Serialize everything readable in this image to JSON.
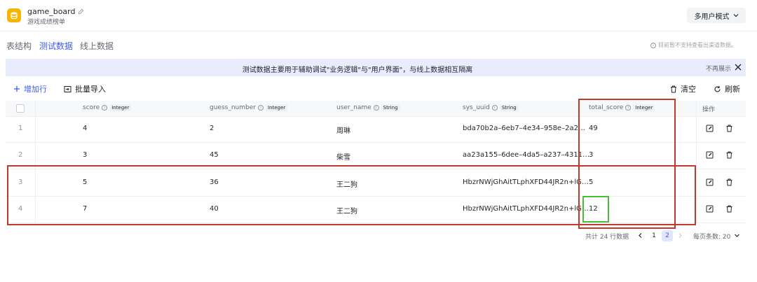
{
  "header": {
    "title": "game_board",
    "subtitle": "游戏成绩榜单",
    "mode_button": "多用户模式"
  },
  "tabs": [
    {
      "label": "表结构",
      "active": false
    },
    {
      "label": "测试数据",
      "active": true
    },
    {
      "label": "线上数据",
      "active": false
    }
  ],
  "tab_note": "目前暂不支持查看出渠道数据。",
  "banner": {
    "text": "测试数据主要用于辅助调试\"业务逻辑\"与\"用户界面\"，与线上数据相互隔离",
    "dismiss": "不再展示"
  },
  "toolbar": {
    "add_row": "增加行",
    "bulk_import": "批量导入",
    "clear": "清空",
    "refresh": "刷新"
  },
  "columns": [
    {
      "name": "score",
      "type": "Integer"
    },
    {
      "name": "guess_number",
      "type": "Integer"
    },
    {
      "name": "user_name",
      "type": "String"
    },
    {
      "name": "sys_uuid",
      "type": "String"
    },
    {
      "name": "total_score",
      "type": "Integer"
    }
  ],
  "ops_header": "操作",
  "rows": [
    {
      "idx": "1",
      "score": "4",
      "guess_number": "2",
      "user_name": "周琳",
      "sys_uuid": "bda70b2a–6eb7–4e34–958e–2a2…",
      "total_score": "49"
    },
    {
      "idx": "2",
      "score": "3",
      "guess_number": "45",
      "user_name": "柴雪",
      "sys_uuid": "aa23a155–6dee–4da5–a237–4311…",
      "total_score": "3"
    },
    {
      "idx": "3",
      "score": "5",
      "guess_number": "36",
      "user_name": "王二狗",
      "sys_uuid": "HbzrNWjGhAitTLphXFD44JR2n+lG…",
      "total_score": "5"
    },
    {
      "idx": "4",
      "score": "7",
      "guess_number": "40",
      "user_name": "王二狗",
      "sys_uuid": "HbzrNWjGhAitTLphXFD44JR2n+lG…",
      "total_score": "12"
    }
  ],
  "pagination": {
    "total_text": "共计 24 行数据",
    "pages": [
      "1",
      "2"
    ],
    "current_page": "2",
    "page_size_text": "每页条数: 20"
  },
  "colors": {
    "accent": "#3c5bf0",
    "annotation_red": "#c0392b",
    "annotation_green": "#4cbb3a",
    "db_icon": "#f7b500"
  }
}
